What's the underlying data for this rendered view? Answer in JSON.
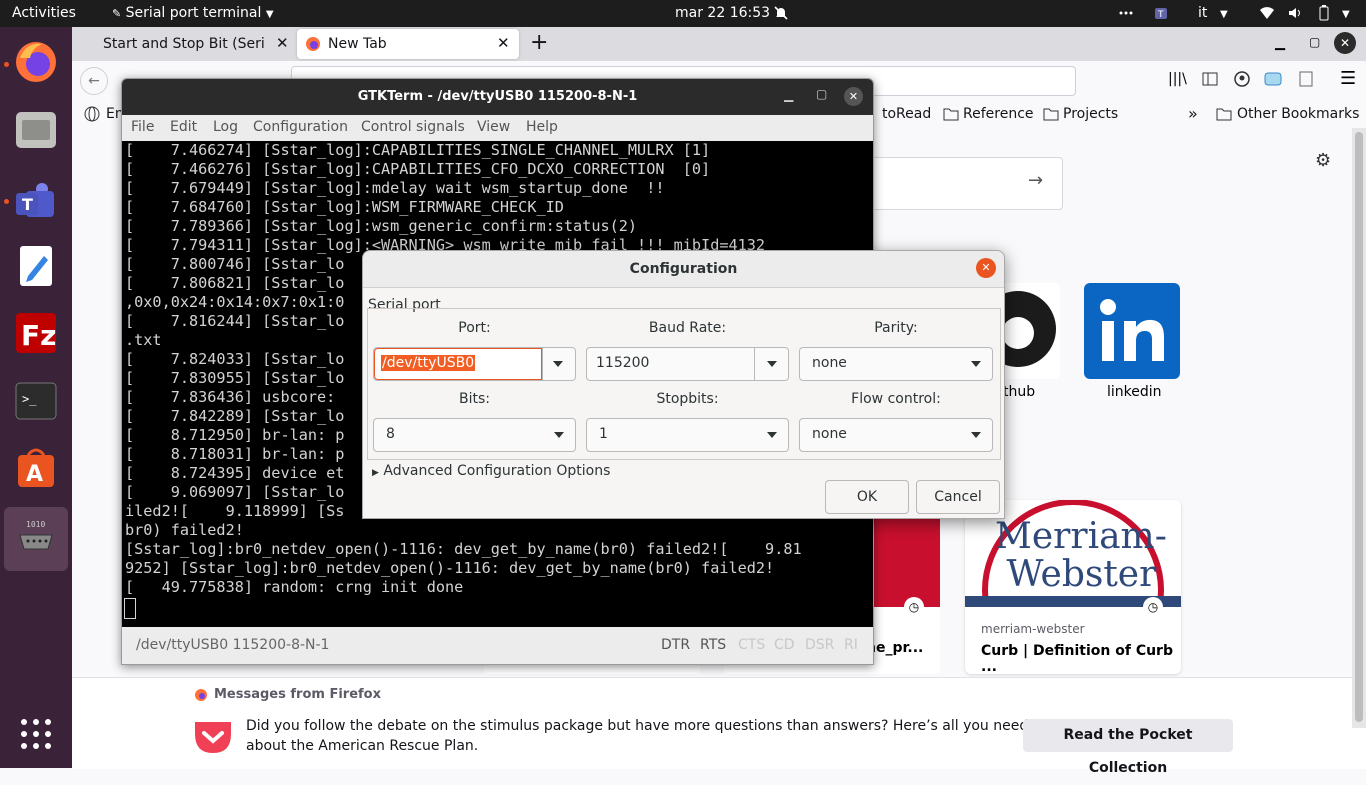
{
  "topbar": {
    "activities": "Activities",
    "app_name": "Serial port terminal",
    "datetime": "mar 22  16:53",
    "lang": "it"
  },
  "firefox": {
    "tabs": [
      {
        "label": "Start and Stop Bit (Serial"
      },
      {
        "label": "New Tab"
      }
    ],
    "bookmarks_left_partial": "Em",
    "bookmarks": [
      "toRead",
      "Reference",
      "Projects"
    ],
    "other_bookmarks": "Other Bookmarks",
    "shortcuts": [
      {
        "label": "thub"
      },
      {
        "label": "linkedin"
      }
    ],
    "cards": [
      {
        "title": "he_pr..."
      },
      {
        "source": "merriam-webster",
        "title": "Curb | Definition of Curb ..."
      }
    ],
    "messages_header": "Messages from Firefox",
    "message_text_line1": "Did you follow the debate on the stimulus package but have more questions than answers? Here’s all you need to know",
    "message_text_line2": "about the American Rescue Plan.",
    "message_button": "Read the Pocket Collection"
  },
  "gtkterm": {
    "title": "GTKTerm - /dev/ttyUSB0  115200-8-N-1",
    "menu": [
      "File",
      "Edit",
      "Log",
      "Configuration",
      "Control signals",
      "View",
      "Help"
    ],
    "terminal_lines": [
      "[    7.466274] [Sstar_log]:CAPABILITIES_SINGLE_CHANNEL_MULRX [1]",
      "[    7.466276] [Sstar_log]:CAPABILITIES_CFO_DCXO_CORRECTION  [0]",
      "[    7.679449] [Sstar_log]:mdelay wait wsm_startup_done  !!",
      "[    7.684760] [Sstar_log]:WSM_FIRMWARE_CHECK_ID",
      "[    7.789366] [Sstar_log]:wsm_generic_confirm:status(2)",
      "[    7.794311] [Sstar_log]:<WARNING> wsm_write_mib fail !!! mibId=4132",
      "[    7.800746] [Sstar_lo",
      "[    7.806821] [Sstar_lo",
      ",0x0,0x24:0x14:0x7:0x1:0",
      "[    7.816244] [Sstar_lo",
      ".txt",
      "[    7.824033] [Sstar_lo",
      "[    7.830955] [Sstar_lo",
      "[    7.836436] usbcore: ",
      "[    7.842289] [Sstar_lo",
      "[    8.712950] br-lan: p",
      "[    8.718031] br-lan: p",
      "[    8.724395] device et",
      "[    9.069097] [Sstar_lo",
      "iled2![    9.118999] [Ss",
      "br0) failed2!",
      "[Sstar_log]:br0_netdev_open()-1116: dev_get_by_name(br0) failed2![    9.81",
      "9252] [Sstar_log]:br0_netdev_open()-1116: dev_get_by_name(br0) failed2!",
      "[   49.775838] random: crng init done",
      ""
    ],
    "status_port": "/dev/ttyUSB0  115200-8-N-1",
    "signals": [
      "DTR",
      "RTS",
      "CTS",
      "CD",
      "DSR",
      "RI"
    ]
  },
  "config_dialog": {
    "title": "Configuration",
    "group_label": "Serial port",
    "port_label": "Port:",
    "port_value": "/dev/ttyUSB0",
    "baud_label": "Baud Rate:",
    "baud_value": "115200",
    "parity_label": "Parity:",
    "parity_value": "none",
    "bits_label": "Bits:",
    "bits_value": "8",
    "stopbits_label": "Stopbits:",
    "stopbits_value": "1",
    "flow_label": "Flow control:",
    "flow_value": "none",
    "advanced_label": "Advanced Configuration Options",
    "ok_label": "OK",
    "cancel_label": "Cancel"
  },
  "colors": {
    "ubuntu_orange": "#e95420",
    "dock_bg": "#3a2238",
    "terminal_bg": "#000000",
    "selection": "#f15d22",
    "linkedin_blue": "#0a66c2",
    "merriam_red": "#c8102e",
    "merriam_blue": "#2f4a7a"
  }
}
